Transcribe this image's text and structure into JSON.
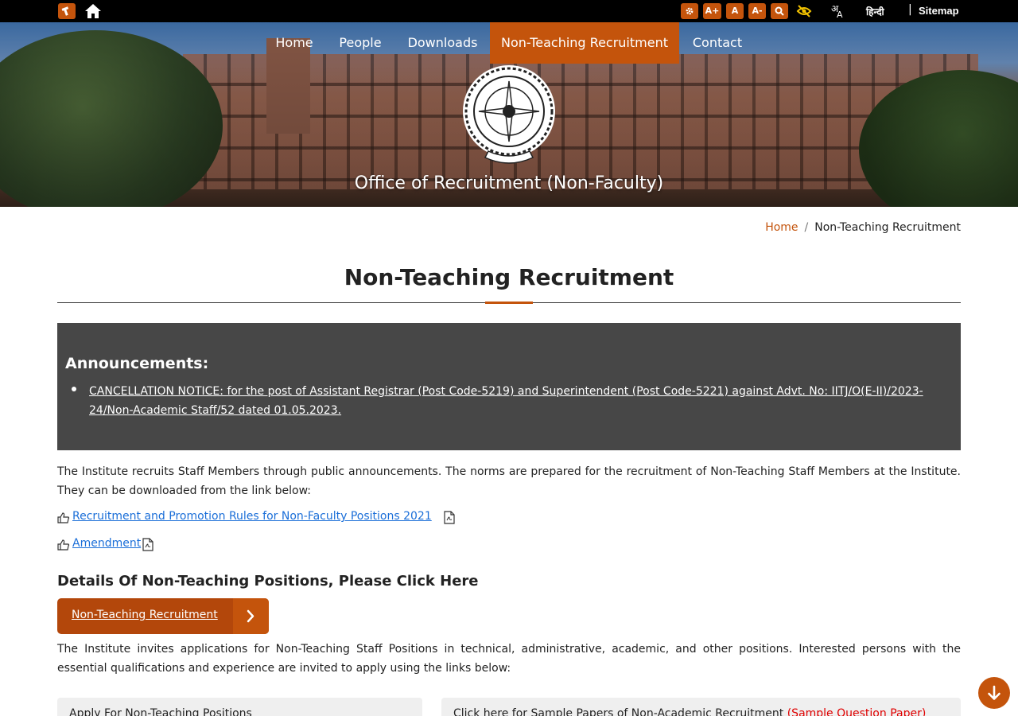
{
  "topbar": {
    "accessibility": [
      "A+",
      "A",
      "A-"
    ],
    "hindi_label": "हिन्दी",
    "separator": "|",
    "sitemap_label": "Sitemap",
    "lang_glyph_top": "अ",
    "lang_glyph_bottom": "A"
  },
  "nav": {
    "items": [
      {
        "label": "Home"
      },
      {
        "label": "People"
      },
      {
        "label": "Downloads"
      },
      {
        "label": "Non-Teaching Recruitment",
        "active": true
      },
      {
        "label": "Contact"
      }
    ]
  },
  "banner": {
    "title": "Office of Recruitment (Non-Faculty)"
  },
  "breadcrumb": {
    "home": "Home",
    "separator": "/",
    "current": "Non-Teaching Recruitment"
  },
  "page": {
    "title": "Non-Teaching Recruitment"
  },
  "announcements": {
    "heading": "Announcements:",
    "items": [
      "CANCELLATION NOTICE: for the post of Assistant Registrar (Post Code-5219) and Superintendent (Post Code-5221) against Advt. No: IITJ/O(E-II)/2023-24/Non-Academic Staff/52 dated 01.05.2023."
    ]
  },
  "intro": {
    "text": "The Institute recruits Staff Members through public announcements. The norms are prepared for the recruitment of Non-Teaching Staff Members at the Institute. They can be downloaded from the link below:"
  },
  "documents": [
    {
      "label": "Recruitment and Promotion Rules for Non-Faculty Positions 2021"
    },
    {
      "label": "Amendment"
    }
  ],
  "details": {
    "heading": "Details Of Non-Teaching Positions, Please Click Here",
    "button_label": "Non-Teaching Recruitment"
  },
  "invite": {
    "text": "The Institute invites applications for Non-Teaching Staff Positions in technical, administrative, academic, and other positions. Interested persons with the essential qualifications and experience are invited to apply using the links below:"
  },
  "cards": [
    {
      "text": "Apply For Non-Teaching Positions"
    },
    {
      "text": "Click here for Sample Papers of Non-Academic Recruitment ",
      "highlight": "(Sample Question Paper)"
    }
  ],
  "colors": {
    "accent": "#c4540c",
    "announcement_bg": "#474747",
    "link": "#1a6ed8",
    "highlight": "#e00000"
  },
  "icons": {
    "topbar": [
      "logo-icon",
      "home-icon",
      "settings-icon",
      "search-icon",
      "eye-slash-icon",
      "language-icon"
    ],
    "documents": [
      "thumbs-up-icon",
      "pdf-file-icon"
    ],
    "cta": "chevron-right-icon",
    "scroll": "arrow-down-icon"
  }
}
